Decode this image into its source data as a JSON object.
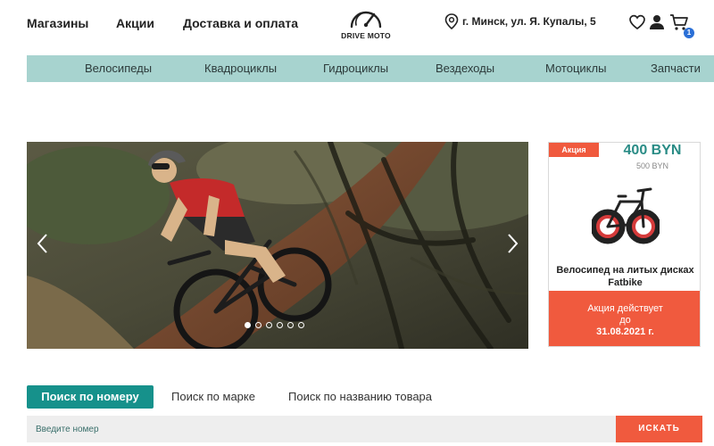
{
  "header": {
    "links": [
      "Магазины",
      "Акции",
      "Доставка и оплата"
    ],
    "logo_text": "DRIVE MOTO",
    "address": "г. Минск, ул. Я. Купалы, 5",
    "cart_count": "1",
    "icons": [
      "location-icon",
      "heart-icon",
      "user-icon",
      "cart-icon"
    ]
  },
  "categories": [
    "Велосипеды",
    "Квадроциклы",
    "Гидроциклы",
    "Вездеходы",
    "Мотоциклы",
    "Запчасти"
  ],
  "slider": {
    "dots": 6,
    "active_dot": 0
  },
  "promo": {
    "tag": "Акция",
    "price": "400 BYN",
    "old_price": "500 BYN",
    "title": "Велосипед на литых дисках Fatbike",
    "valid_line1": "Акция действует",
    "valid_line2": "до",
    "valid_date": "31.08.2021 г."
  },
  "search": {
    "tabs": [
      "Поиск по номеру",
      "Поиск по марке",
      "Поиск по названию товара"
    ],
    "active_tab": 0,
    "placeholder": "Введите номер",
    "button": "ИСКАТЬ"
  },
  "colors": {
    "accent_teal": "#16918b",
    "nav_bg": "#a7d3cf",
    "accent_orange": "#f05a3e",
    "badge_blue": "#2a6fd6"
  }
}
